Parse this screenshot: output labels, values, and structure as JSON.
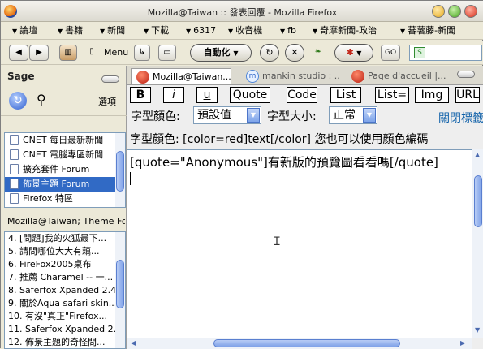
{
  "window": {
    "title": "Mozilla@Taiwan :: 發表回覆 - Mozilla Firefox"
  },
  "bookmarks": [
    {
      "label": "論壇"
    },
    {
      "label": "書籍"
    },
    {
      "label": "新聞"
    },
    {
      "label": "下載"
    },
    {
      "label": "6317"
    },
    {
      "label": "收音機"
    },
    {
      "label": "fb"
    },
    {
      "label": "奇摩新聞-政治"
    },
    {
      "label": "蕃薯藤-新聞"
    }
  ],
  "toolbar": {
    "menu_label": "Menu",
    "automation_label": "自動化",
    "go_label": "GO"
  },
  "sidebar": {
    "title": "Sage",
    "options_label": "選項",
    "feeds": [
      {
        "label": "CNET 每日最新新聞"
      },
      {
        "label": "CNET 電腦專區新聞"
      },
      {
        "label": "擴充套件 Forum"
      },
      {
        "label": "佈景主題 Forum",
        "selected": true
      },
      {
        "label": "Firefox 特區"
      }
    ],
    "feed_title": "Mozilla@Taiwan; Theme Forum",
    "items": [
      {
        "label": "4. [問題]我的火狐最下..."
      },
      {
        "label": "5. 請問哪位大大有藕..."
      },
      {
        "label": "6. FireFox2005桌布"
      },
      {
        "label": "7. 推薦 Charamel -- 一..."
      },
      {
        "label": "8. Saferfox Xpanded 2.4..."
      },
      {
        "label": "9. 關於Aqua safari skin..."
      },
      {
        "label": "10. 有沒\"真正\"Firefox..."
      },
      {
        "label": "11. Saferfox Xpanded 2...."
      },
      {
        "label": "12. 佈景主題的奇怪問..."
      }
    ]
  },
  "tabs": [
    {
      "label": "Mozilla@Taiwan...",
      "active": true
    },
    {
      "label": "mankin studio : ..."
    },
    {
      "label": "Page d'accueil |..."
    }
  ],
  "editor": {
    "format_buttons": [
      "B",
      "i",
      "u",
      "Quote",
      "Code",
      "List",
      "List=",
      "Img",
      "URL"
    ],
    "font_color_label": "字型顏色:",
    "font_color_value": "預設值",
    "font_size_label": "字型大小:",
    "font_size_value": "正常",
    "close_tags_label": "關閉標籤",
    "hint": "字型顏色: [color=red]text[/color]  您也可以使用顏色編碼",
    "body": "[quote=\"Anonymous\"]有新版的預覽圖看看嗎[/quote]"
  },
  "colors": {
    "selection": "#316ac5",
    "scroll_thumb": "#7fa2e8",
    "link": "#0b5ea8"
  },
  "icons": [
    "firefox-icon",
    "back-icon",
    "forward-icon",
    "reload-icon",
    "stop-icon",
    "search-icon",
    "sage-refresh-icon",
    "feed-doc-icon",
    "rss-icon"
  ]
}
